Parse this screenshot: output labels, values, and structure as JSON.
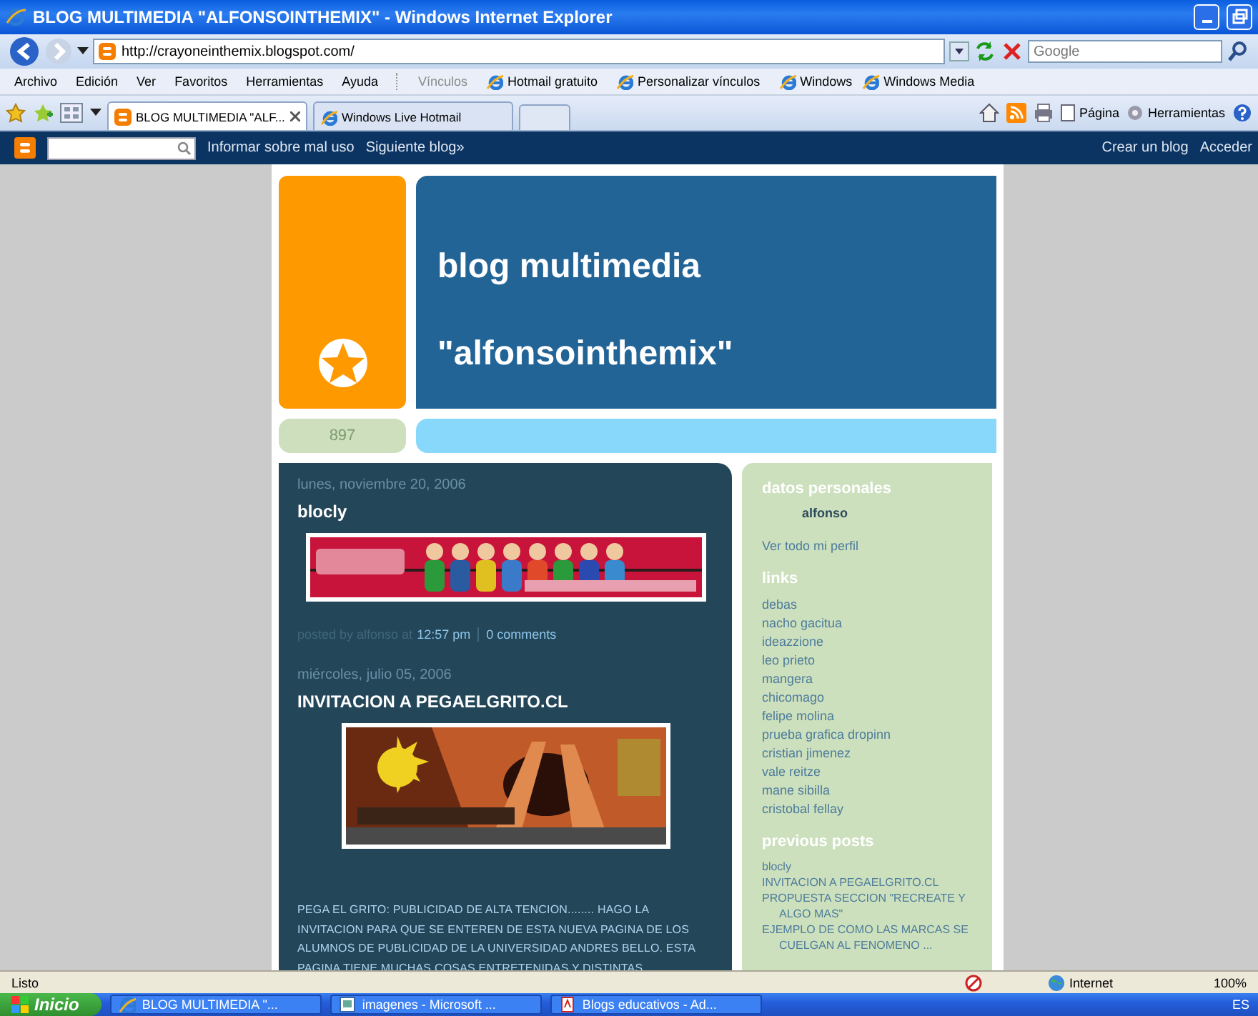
{
  "window": {
    "title": "BLOG MULTIMEDIA \"ALFONSOINTHEMIX\" - Windows Internet Explorer"
  },
  "address_bar": {
    "url": "http://crayoneinthemix.blogspot.com/",
    "search_placeholder": "Google"
  },
  "menu": [
    "Archivo",
    "Edición",
    "Ver",
    "Favoritos",
    "Herramientas",
    "Ayuda"
  ],
  "links_bar": {
    "label": "Vínculos",
    "items": [
      "Hotmail gratuito",
      "Personalizar vínculos",
      "Windows",
      "Windows Media"
    ]
  },
  "tabs": [
    {
      "label": "BLOG MULTIMEDIA \"ALF...",
      "selected": true
    },
    {
      "label": "Windows Live Hotmail",
      "selected": false
    }
  ],
  "command_bar": [
    "Página",
    "Herramientas"
  ],
  "blogger_bar": {
    "links": [
      "Informar sobre mal uso",
      "Siguiente blog»"
    ],
    "right_links": [
      "Crear un blog",
      "Acceder"
    ]
  },
  "blog": {
    "title_line1": "blog multimedia",
    "title_line2": "\"alfonsointhemix\"",
    "counter": "897",
    "posts": [
      {
        "date": "lunes, noviembre 20, 2006",
        "title": "blocly",
        "footer": {
          "prefix": "posted by alfonso at",
          "time": "12:57 pm",
          "comments": "0 comments"
        }
      },
      {
        "date": "miércoles, julio 05, 2006",
        "title": "INVITACION A PEGAELGRITO.CL",
        "body": "PEGA EL GRITO: PUBLICIDAD DE ALTA TENCION........ HAGO LA INVITACION PARA QUE SE ENTEREN DE ESTA NUEVA PAGINA DE LOS ALUMNOS DE PUBLICIDAD DE LA UNIVERSIDAD ANDRES BELLO. ESTA PAGINA TIENE MUCHAS COSAS ENTRETENIDAS Y DISTINTAS"
      }
    ],
    "sidebar": {
      "profile_heading": "datos personales",
      "profile_name": "alfonso",
      "profile_link": "Ver todo mi perfil",
      "links_heading": "links",
      "links": [
        "debas",
        "nacho gacitua",
        "ideazzione",
        "leo prieto",
        "mangera",
        "chicomago",
        "felipe molina",
        "prueba grafica dropinn",
        "cristian jimenez",
        "vale reitze",
        "mane sibilla",
        "cristobal fellay"
      ],
      "previous_heading": "previous posts",
      "previous": [
        "blocly",
        "INVITACION A PEGAELGRITO.CL",
        "PROPUESTA SECCION \"RECREATE Y ALGO MAS\"",
        "EJEMPLO DE COMO LAS MARCAS SE CUELGAN AL FENOMENO ..."
      ]
    }
  },
  "status_bar": {
    "text": "Listo",
    "zone": "Internet",
    "zoom": "100%"
  },
  "taskbar": {
    "start": "Inicio",
    "items": [
      "BLOG MULTIMEDIA \"...",
      "imagenes - Microsoft ...",
      "Blogs educativos - Ad..."
    ],
    "language": "ES"
  }
}
